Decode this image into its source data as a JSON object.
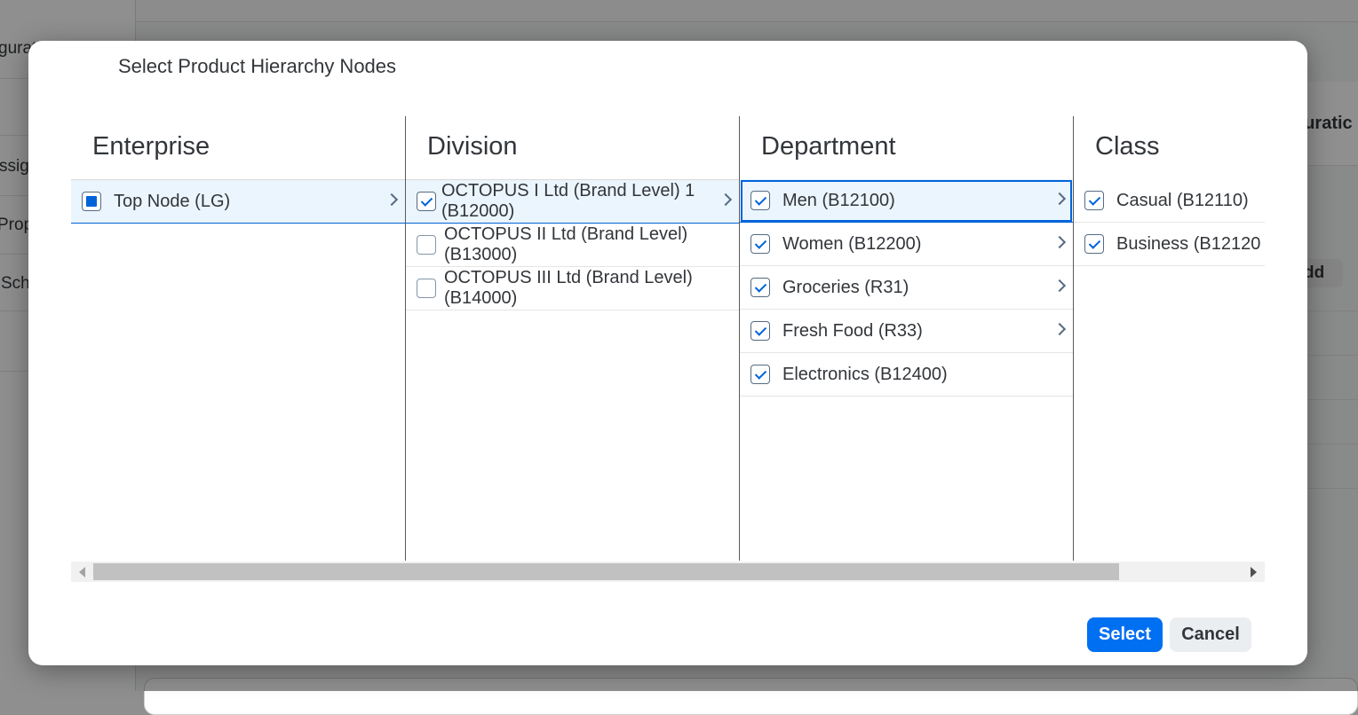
{
  "background": {
    "sidebar_fragments": [
      "gurat",
      "ssig",
      "Prop",
      "Sch"
    ],
    "right_header_fragment": "guratic",
    "add_fragment": "dd"
  },
  "dialog": {
    "title": "Select Product Hierarchy Nodes",
    "columns": [
      {
        "header": "Enterprise",
        "items": [
          {
            "label": "Top Node (LG)",
            "state": "partial",
            "navigable": true,
            "selected": true
          }
        ]
      },
      {
        "header": "Division",
        "items": [
          {
            "line1": "OCTOPUS I Ltd (Brand Level) 1",
            "line2": "(B12000)",
            "state": "checked",
            "navigable": true,
            "selected": true
          },
          {
            "line1": "OCTOPUS II Ltd (Brand Level)",
            "line2": "(B13000)",
            "state": "unchecked",
            "navigable": false
          },
          {
            "line1": "OCTOPUS III Ltd (Brand Level)",
            "line2": "(B14000)",
            "state": "unchecked",
            "navigable": false
          }
        ]
      },
      {
        "header": "Department",
        "items": [
          {
            "label": "Men (B12100)",
            "state": "checked",
            "navigable": true,
            "selected": true,
            "focused": true
          },
          {
            "label": "Women (B12200)",
            "state": "checked",
            "navigable": true
          },
          {
            "label": "Groceries (R31)",
            "state": "checked",
            "navigable": true
          },
          {
            "label": "Fresh Food (R33)",
            "state": "checked",
            "navigable": true
          },
          {
            "label": "Electronics (B12400)",
            "state": "checked",
            "navigable": false
          }
        ]
      },
      {
        "header": "Class",
        "items": [
          {
            "label": "Casual (B12110)",
            "state": "checked",
            "navigable": false
          },
          {
            "label": "Business (B12120",
            "state": "checked",
            "navigable": false
          }
        ]
      }
    ],
    "buttons": {
      "select": "Select",
      "cancel": "Cancel"
    }
  },
  "colors": {
    "accent": "#0070f2",
    "selected_row": "#ebf5fe",
    "text": "#32363a"
  }
}
